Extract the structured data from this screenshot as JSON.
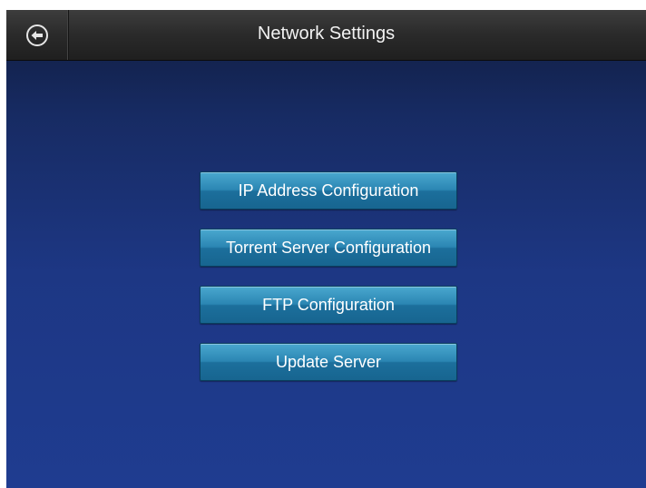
{
  "header": {
    "title": "Network Settings",
    "back_icon": "back-arrow-circle-icon"
  },
  "menu": {
    "items": [
      {
        "label": "IP Address Configuration"
      },
      {
        "label": "Torrent Server Configuration"
      },
      {
        "label": "FTP Configuration"
      },
      {
        "label": "Update Server"
      }
    ]
  },
  "colors": {
    "background_top": "#101c3e",
    "background_bottom": "#1f3c90",
    "header": "#2a2a2a",
    "button": "#2b86b3",
    "text": "#ffffff"
  }
}
